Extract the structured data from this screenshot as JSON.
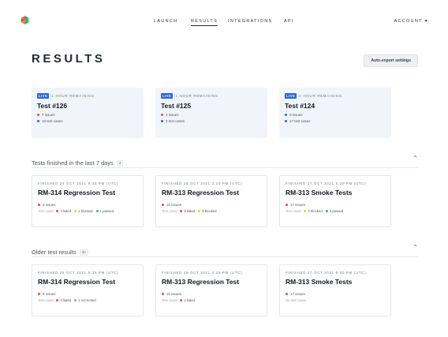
{
  "nav": {
    "links": [
      "LAUNCH",
      "RESULTS",
      "INTEGRATIONS",
      "API"
    ],
    "active": "RESULTS",
    "account": "ACCOUNT"
  },
  "page": {
    "title": "RESULTS",
    "export_button": "Auto-export settings"
  },
  "colors": {
    "accent_blue": "#2563eb",
    "issue_red": "#ef4444",
    "blocked_yellow": "#facc15",
    "passed_green": "#22c55e",
    "not_tested_gray": "#9ca3af",
    "live_card_bg": "#f1f4f9"
  },
  "live_tests": [
    {
      "badge": "LIVE",
      "remaining": "1 HOUR REMAINING",
      "title": "Test #126",
      "issues": "7 issues",
      "issues_color": "red",
      "cases": "10 test cases"
    },
    {
      "badge": "LIVE",
      "remaining": "1 HOUR REMAINING",
      "title": "Test #125",
      "issues": "4 issues",
      "issues_color": "red",
      "cases": "3 test cases"
    },
    {
      "badge": "LIVE",
      "remaining": "1 HOUR REMAINING",
      "title": "Test #124",
      "issues": "0 issues",
      "issues_color": "blue",
      "cases": "17 test cases"
    }
  ],
  "recent": {
    "title": "Tests finished in the last 7 days",
    "count": "3",
    "cards": [
      {
        "finished": "FINISHED 26 OCT 2021 5:30 PM (UTC)",
        "title": "RM-314 Regression Test",
        "issues": "5 issues",
        "tc_label": "Test cases",
        "tc": [
          {
            "text": "3 failed",
            "color": "red"
          },
          {
            "text": "1 blocked",
            "color": "yellow"
          },
          {
            "text": "1 passed",
            "color": "green"
          }
        ]
      },
      {
        "finished": "FINISHED 28 OCT 2021 3:20 PM (UTC)",
        "title": "RM-313 Regression Test",
        "issues": "10 issues",
        "tc_label": "Test cases",
        "tc": [
          {
            "text": "5 failed",
            "color": "red"
          },
          {
            "text": "3 blocked",
            "color": "yellow"
          }
        ]
      },
      {
        "finished": "FINISHED 27 OCT 2021 5:30 PM (UTC)",
        "title": "RM-313 Smoke Tests",
        "issues": "17 issues",
        "tc_label": "Test cases",
        "tc": [
          {
            "text": "2 blocked",
            "color": "yellow"
          },
          {
            "text": "3 passed",
            "color": "green"
          }
        ]
      }
    ]
  },
  "older": {
    "title": "Older test results",
    "count": "40",
    "cards": [
      {
        "finished": "FINISHED 26 OCT 2021 5:30 PM (UTC)",
        "title": "RM-314 Regression Test",
        "issues": "5 issues",
        "tc_label": "Test cases",
        "tc": [
          {
            "text": "3 failed",
            "color": "red"
          },
          {
            "text": "1 not tested",
            "color": "gray"
          }
        ]
      },
      {
        "finished": "FINISHED 28 OCT 2021 3:20 PM (UTC)",
        "title": "RM-313 Regression Test",
        "issues": "10 issues",
        "tc_label": "Test cases",
        "tc": [
          {
            "text": "4 failed",
            "color": "red"
          }
        ]
      },
      {
        "finished": "FINISHED 27 OCT 2021 5:30 PM (UTC)",
        "title": "RM-313 Smoke Tests",
        "issues": "17 issues",
        "tc_label": "No test cases",
        "tc": []
      }
    ]
  }
}
